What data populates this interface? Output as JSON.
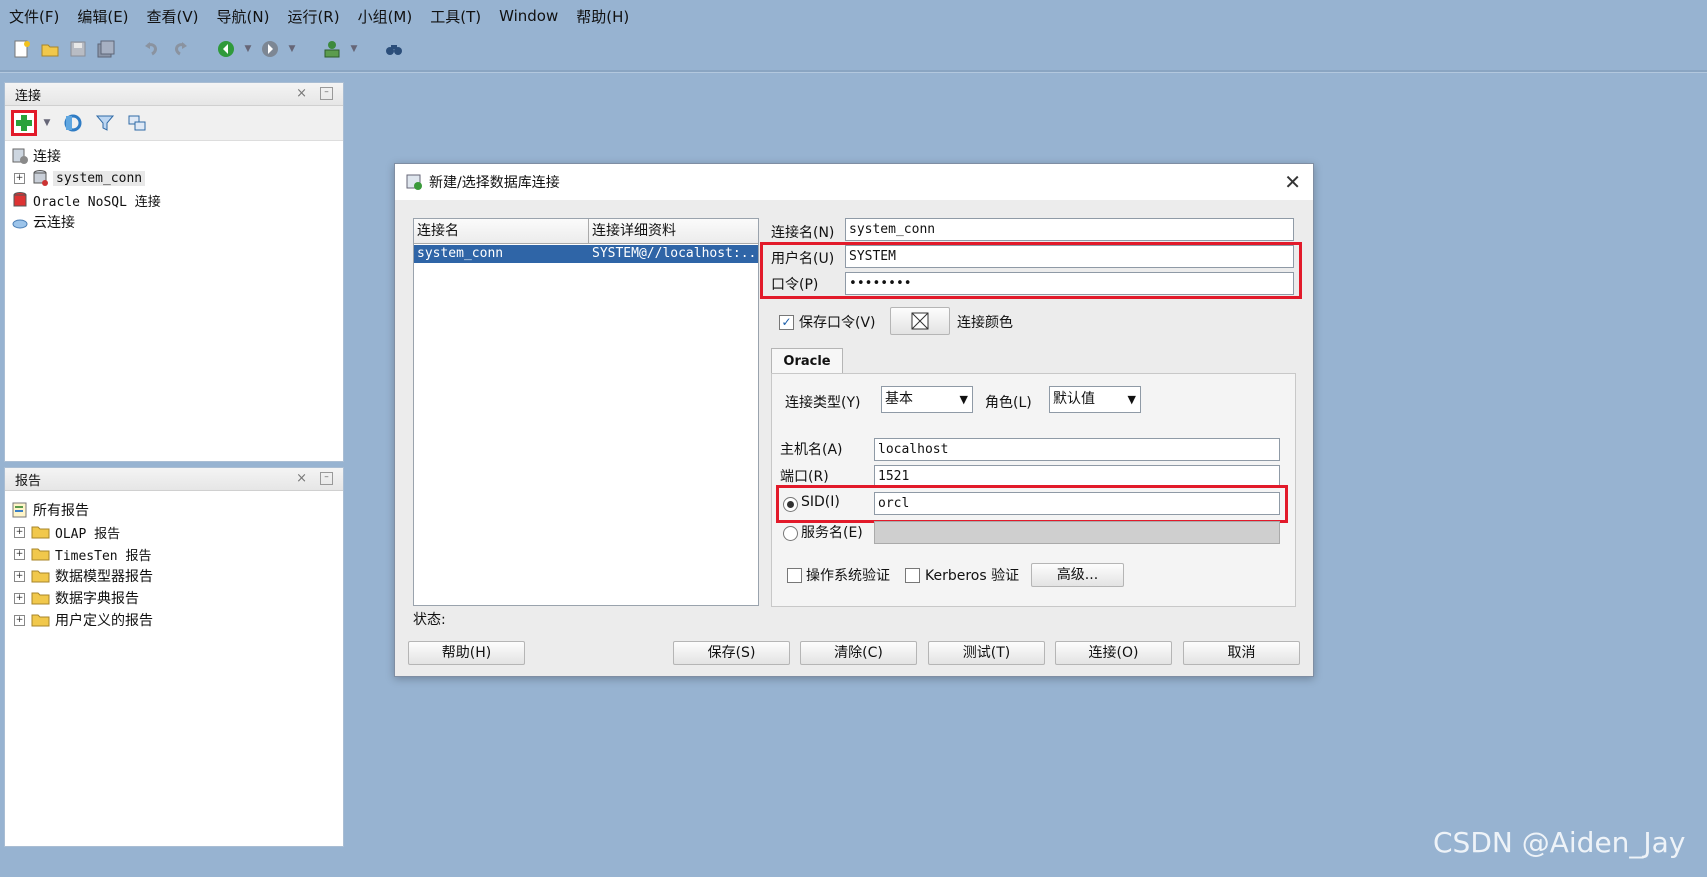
{
  "menu": [
    "文件(F)",
    "编辑(E)",
    "查看(V)",
    "导航(N)",
    "运行(R)",
    "小组(M)",
    "工具(T)",
    "Window",
    "帮助(H)"
  ],
  "toolbar_icons": [
    "new-icon",
    "open-folder-icon",
    "save-icon",
    "save-all-icon",
    "undo-icon",
    "redo-icon",
    "back-icon",
    "forward-icon",
    "sql-worksheet-icon",
    "find-db-object-icon"
  ],
  "connections_panel": {
    "title": "连接",
    "tree": {
      "root": "连接",
      "child": "system_conn",
      "nosql": "Oracle NoSQL 连接",
      "cloud": "云连接"
    }
  },
  "reports_panel": {
    "title": "报告",
    "root": "所有报告",
    "items": [
      "OLAP 报告",
      "TimesTen 报告",
      "数据模型器报告",
      "数据字典报告",
      "用户定义的报告"
    ]
  },
  "dialog": {
    "title": "新建/选择数据库连接",
    "table": {
      "headers": [
        "连接名",
        "连接详细资料"
      ],
      "rows": [
        [
          "system_conn",
          "SYSTEM@//localhost:..."
        ]
      ]
    },
    "conn_name_label": "连接名(N)",
    "conn_name_value": "system_conn",
    "username_label": "用户名(U)",
    "username_value": "SYSTEM",
    "password_label": "口令(P)",
    "password_value": "••••••••",
    "save_password_label": "保存口令(V)",
    "save_password_checked": true,
    "conn_color_label": "连接颜色",
    "tab_label": "Oracle",
    "conn_type_label": "连接类型(Y)",
    "conn_type_value": "基本",
    "role_label": "角色(L)",
    "role_value": "默认值",
    "host_label": "主机名(A)",
    "host_value": "localhost",
    "port_label": "端口(R)",
    "port_value": "1521",
    "sid_label": "SID(I)",
    "sid_value": "orcl",
    "service_label": "服务名(E)",
    "service_value": "",
    "os_auth_label": "操作系统验证",
    "kerberos_label": "Kerberos 验证",
    "advanced_button": "高级...",
    "status_label": "状态:",
    "buttons": {
      "help": "帮助(H)",
      "save": "保存(S)",
      "clear": "清除(C)",
      "test": "测试(T)",
      "connect": "连接(O)",
      "cancel": "取消"
    }
  },
  "highlight_color": "#e21a2a",
  "selection_color": "#2f65a7",
  "watermark": "CSDN @Aiden_Jay"
}
